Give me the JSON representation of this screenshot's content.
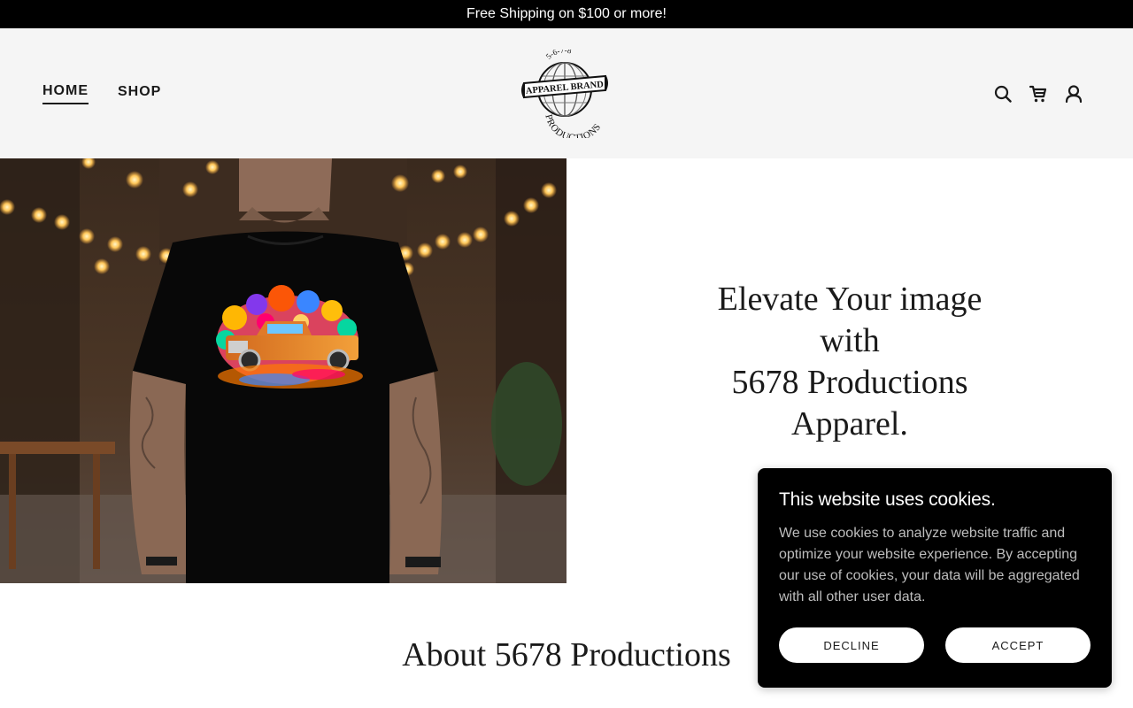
{
  "announcement": "Free Shipping on $100 or more!",
  "nav": {
    "items": [
      {
        "label": "HOME",
        "active": true
      },
      {
        "label": "SHOP",
        "active": false
      }
    ]
  },
  "logo": {
    "top_text": "5-6-7-8",
    "banner_text": "APPAREL BRAND",
    "bottom_text": "PRODUCTIONS"
  },
  "header_icons": [
    "search-icon",
    "cart-icon",
    "account-icon"
  ],
  "hero": {
    "image_alt": "Man wearing black t-shirt with colorful truck graphic",
    "headline_lines": [
      "Elevate Your image",
      "with",
      "5678 Productions",
      "Apparel."
    ]
  },
  "about": {
    "title": "About 5678 Productions"
  },
  "cookie_banner": {
    "title": "This website uses cookies.",
    "body": "We use cookies to analyze website traffic and optimize your website experience. By accepting our use of cookies, your data will be aggregated with all other user data.",
    "decline_label": "DECLINE",
    "accept_label": "ACCEPT"
  },
  "colors": {
    "announcement_bg": "#000000",
    "header_bg": "#f5f5f5",
    "text": "#1a1a1a",
    "cookie_bg": "#000000"
  }
}
